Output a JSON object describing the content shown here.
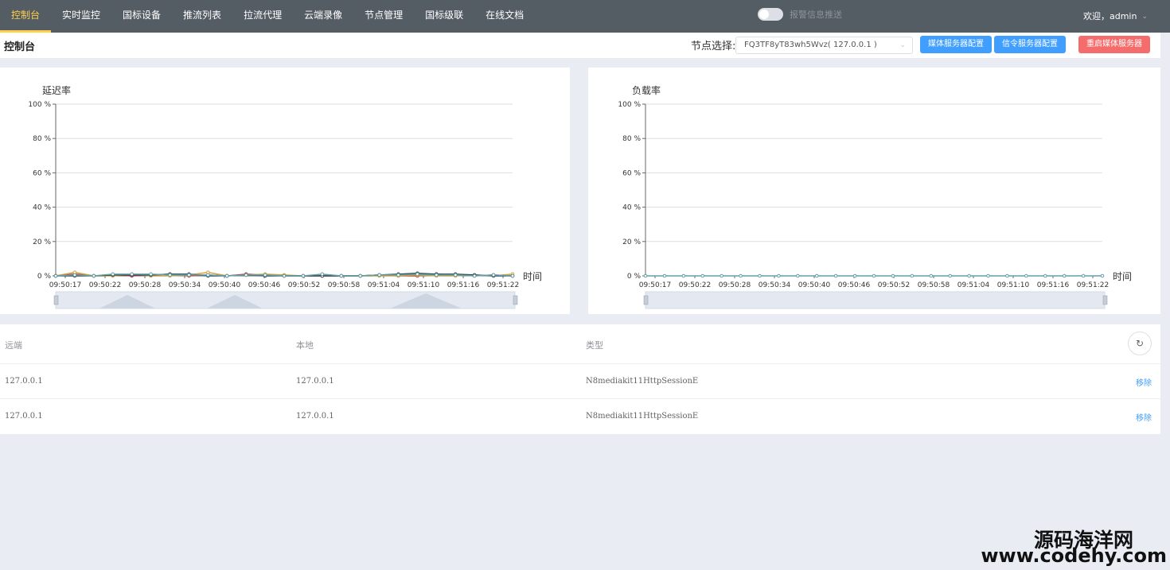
{
  "nav": {
    "items": [
      "控制台",
      "实时监控",
      "国标设备",
      "推流列表",
      "拉流代理",
      "云端录像",
      "节点管理",
      "国标级联",
      "在线文档"
    ],
    "active_index": 0,
    "alarm_label": "报警信息推送",
    "alarm_on": false,
    "welcome": "欢迎，admin"
  },
  "header": {
    "title": "控制台",
    "node_label": "节点选择:",
    "node_value": "FQ3TF8yT83wh5Wvz( 127.0.0.1 )",
    "btn_media_config": "媒体服务器配置",
    "btn_signal_config": "信令服务器配置",
    "btn_restart": "重启媒体服务器"
  },
  "chart_data": [
    {
      "type": "line",
      "title": "延迟率",
      "xlabel": "时间",
      "ylabel": "",
      "ylim": [
        0,
        100
      ],
      "yticks": [
        "0 %",
        "20 %",
        "40 %",
        "60 %",
        "80 %",
        "100 %"
      ],
      "x": [
        "09:50:17",
        "09:50:22",
        "09:50:28",
        "09:50:34",
        "09:50:40",
        "09:50:46",
        "09:50:52",
        "09:50:58",
        "09:51:04",
        "09:51:10",
        "09:51:16",
        "09:51:22"
      ],
      "series": [
        {
          "color": "#c23531",
          "values": [
            0,
            1,
            0,
            0.5,
            0,
            0.5,
            1,
            0,
            0.5,
            0,
            1,
            0.5,
            0,
            0,
            0,
            0,
            0,
            0.5,
            0,
            0,
            1,
            0.5,
            0,
            0.5,
            0
          ]
        },
        {
          "color": "#d4a03a",
          "values": [
            0,
            2,
            0,
            0,
            1,
            0,
            0,
            0.5,
            2,
            0,
            0.5,
            1,
            0.5,
            0,
            0,
            0,
            0,
            0,
            0,
            0.5,
            0,
            0,
            0.5,
            0,
            1
          ]
        },
        {
          "color": "#2f4554",
          "values": [
            0,
            0,
            0,
            0.5,
            0.5,
            0.5,
            1,
            1,
            0,
            0,
            0.5,
            0,
            0,
            0,
            0,
            0,
            0,
            0.5,
            1,
            1.5,
            1,
            1,
            0.5,
            0,
            0
          ]
        },
        {
          "color": "#61a0a8",
          "values": [
            0,
            0.5,
            0,
            1,
            1,
            1,
            0.5,
            0.5,
            0.5,
            0,
            0.5,
            0.5,
            0,
            0,
            1,
            0,
            0,
            0.5,
            0.5,
            1,
            0.5,
            0.5,
            0,
            0.5,
            0
          ]
        }
      ]
    },
    {
      "type": "line",
      "title": "负载率",
      "xlabel": "时间",
      "ylabel": "",
      "ylim": [
        0,
        100
      ],
      "yticks": [
        "0 %",
        "20 %",
        "40 %",
        "60 %",
        "80 %",
        "100 %"
      ],
      "x": [
        "09:50:17",
        "09:50:22",
        "09:50:28",
        "09:50:34",
        "09:50:40",
        "09:50:46",
        "09:50:52",
        "09:50:58",
        "09:51:04",
        "09:51:10",
        "09:51:16",
        "09:51:22"
      ],
      "series": [
        {
          "color": "#61a0a8",
          "values": [
            0,
            0,
            0,
            0,
            0,
            0,
            0,
            0,
            0,
            0,
            0,
            0,
            0,
            0,
            0,
            0,
            0,
            0,
            0,
            0,
            0,
            0,
            0,
            0,
            0
          ]
        }
      ]
    }
  ],
  "table": {
    "columns": [
      "远端",
      "本地",
      "类型"
    ],
    "rows": [
      {
        "remote": "127.0.0.1",
        "local": "127.0.0.1",
        "type": "N8mediakit11HttpSessionE",
        "action": "移除"
      },
      {
        "remote": "127.0.0.1",
        "local": "127.0.0.1",
        "type": "N8mediakit11HttpSessionE",
        "action": "移除"
      }
    ]
  },
  "watermark": {
    "line1": "源码海洋网",
    "line2": "www.codehy.com"
  }
}
